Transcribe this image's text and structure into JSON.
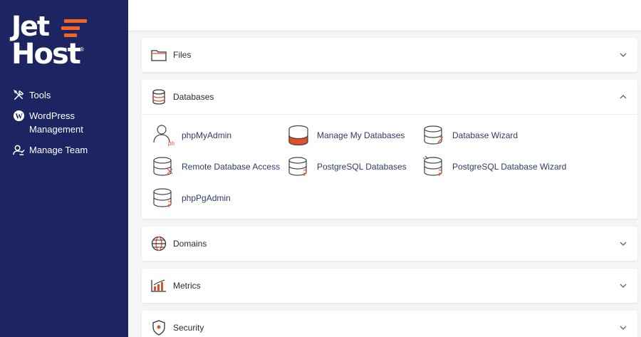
{
  "brand": {
    "line1": "Jet",
    "line2": "Host",
    "mark": "®",
    "accent": "#f26522",
    "sidebar_bg": "#1c2461"
  },
  "sidebar": {
    "items": [
      {
        "label": "Tools",
        "icon": "tools-icon"
      },
      {
        "label": "WordPress\nManagement",
        "icon": "wordpress-icon"
      },
      {
        "label": "Manage Team",
        "icon": "team-icon"
      }
    ]
  },
  "sections": {
    "files": {
      "title": "Files",
      "icon": "folder-icon",
      "state": "collapsed"
    },
    "databases": {
      "title": "Databases",
      "icon": "database-icon",
      "state": "expanded",
      "apps": [
        {
          "label": "phpMyAdmin",
          "icon": "phpmyadmin-icon"
        },
        {
          "label": "Manage My Databases",
          "icon": "manage-databases-icon"
        },
        {
          "label": "Database Wizard",
          "icon": "database-wizard-icon"
        },
        {
          "label": "Remote Database Access",
          "icon": "remote-database-icon"
        },
        {
          "label": "PostgreSQL Databases",
          "icon": "postgresql-icon"
        },
        {
          "label": "PostgreSQL Database Wizard",
          "icon": "postgresql-wizard-icon"
        },
        {
          "label": "phpPgAdmin",
          "icon": "phppgadmin-icon"
        }
      ]
    },
    "domains": {
      "title": "Domains",
      "icon": "globe-icon",
      "state": "collapsed"
    },
    "metrics": {
      "title": "Metrics",
      "icon": "bar-chart-icon",
      "state": "collapsed"
    },
    "security": {
      "title": "Security",
      "icon": "shield-icon",
      "state": "collapsed"
    }
  }
}
